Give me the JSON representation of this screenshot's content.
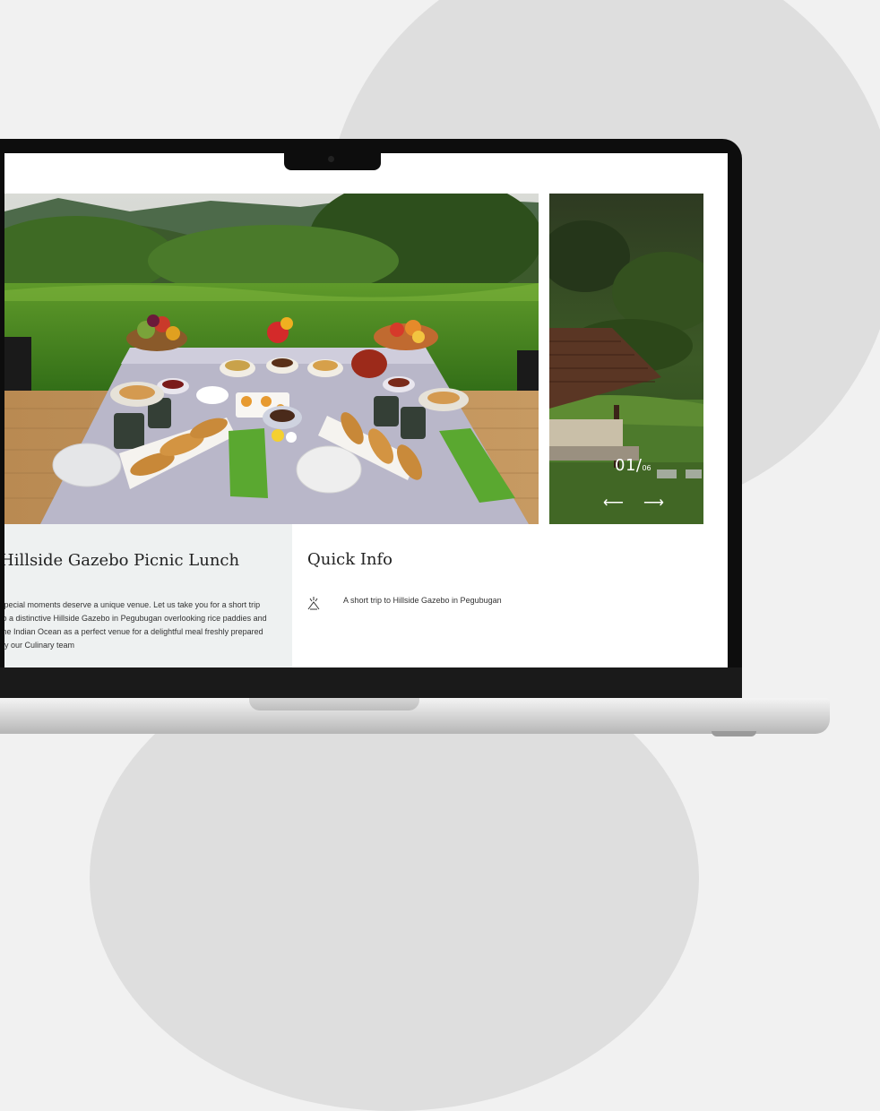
{
  "gallery": {
    "counter_current": "01/",
    "counter_total": "06",
    "prev_arrow": "⟵",
    "next_arrow": "⟶"
  },
  "event": {
    "title": "Hillside Gazebo Picnic Lunch",
    "description": "special moments deserve a unique venue. Let us take you for a short trip to a distinctive Hillside Gazebo in Pegubugan overlooking rice paddies and the Indian Ocean as a perfect venue for a delightful meal freshly prepared by our Culinary team"
  },
  "quick_info": {
    "title": "Quick Info",
    "items": [
      {
        "icon": "gazebo-icon",
        "text": "A short trip to Hillside Gazebo in Pegubugan"
      }
    ]
  },
  "colors": {
    "page_background": "#f1f1f1",
    "panel_background": "#eef1f1",
    "bezel": "#0d0d0d"
  }
}
